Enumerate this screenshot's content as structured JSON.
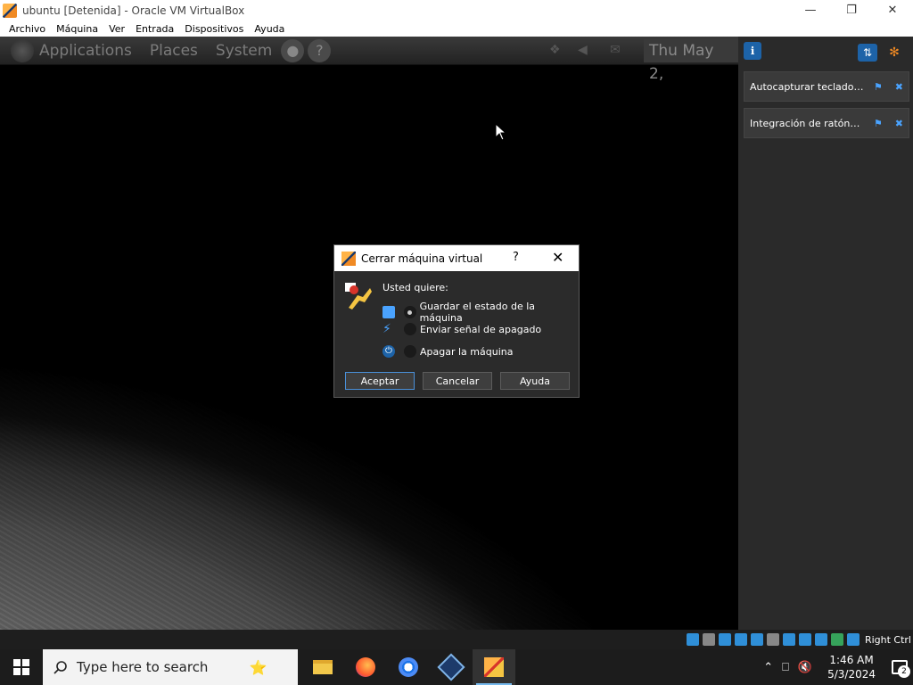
{
  "window": {
    "title": "ubuntu [Detenida] - Oracle VM VirtualBox",
    "minimize_icon": "minimize-icon",
    "maximize_icon": "restore-icon",
    "close_icon": "close-icon"
  },
  "menubar": {
    "items": [
      "Archivo",
      "Máquina",
      "Ver",
      "Entrada",
      "Dispositivos",
      "Ayuda"
    ]
  },
  "guest_panel": {
    "menus": [
      "Applications",
      "Places",
      "System"
    ],
    "help_glyph": "?",
    "clock": "Thu May  2,"
  },
  "side_panel": {
    "notifications": [
      {
        "text": "Autocapturar teclado…"
      },
      {
        "text": "Integración de ratón…"
      }
    ]
  },
  "dialog": {
    "title": "Cerrar máquina virtual",
    "help_glyph": "?",
    "close_glyph": "✕",
    "question": "Usted quiere:",
    "options": [
      {
        "label": "Guardar el estado de la máquina",
        "selected": true,
        "icon": "save-state-icon",
        "color": "#4aa3ff"
      },
      {
        "label": "Enviar señal de apagado",
        "selected": false,
        "icon": "acpi-shutdown-icon",
        "color": "#4aa3ff"
      },
      {
        "label": "Apagar la máquina",
        "selected": false,
        "icon": "power-off-icon",
        "color": "#4aa3ff"
      }
    ],
    "buttons": {
      "ok": "Aceptar",
      "cancel": "Cancelar",
      "help": "Ayuda"
    }
  },
  "statusbar": {
    "host_key": "Right Ctrl"
  },
  "taskbar": {
    "search_placeholder": "Type here to search",
    "apps": [
      "file-explorer-icon",
      "firefox-icon",
      "chrome-icon",
      "virtualbox-icon",
      "virtualbox-vm-icon"
    ],
    "time": "1:46 AM",
    "date": "5/3/2024",
    "notification_count": "2"
  },
  "colors": {
    "accent": "#4a90d9",
    "dialog_bg": "#2b2b2b",
    "taskbar_bg": "#1c1c1c"
  }
}
